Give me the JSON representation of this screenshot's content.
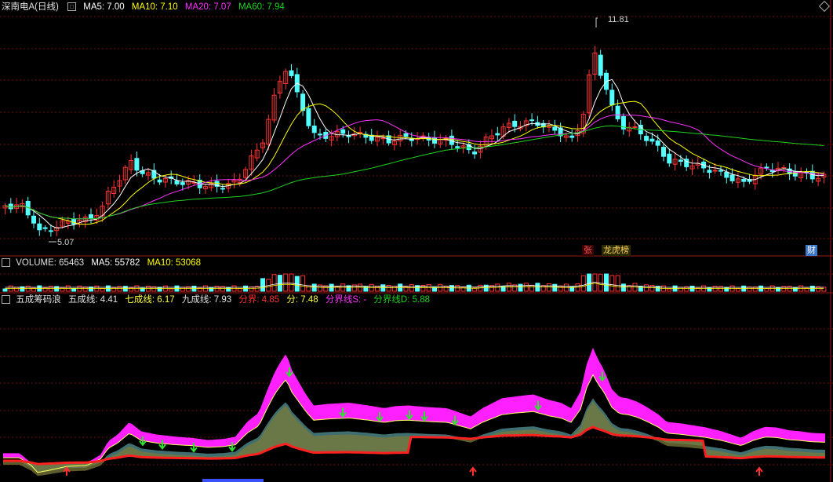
{
  "colors": {
    "up": "#ff3232",
    "down": "#54ffff",
    "ma5": "#ffffff",
    "ma10": "#ffff00",
    "ma20": "#ff32ff",
    "ma60": "#1fd321",
    "grid": "#6e1111",
    "sep": "#9b1a1a"
  },
  "main_panel": {
    "stock_name": "深南电A(日线)",
    "ma5_label": "MA5: 7.00",
    "ma10_label": "MA10: 7.10",
    "ma20_label": "MA20: 7.07",
    "ma60_label": "MA60: 7.94",
    "high_label": "11.81",
    "low_label": "5.07",
    "tags": {
      "zhang": "张",
      "longhu": "龙虎榜",
      "cai": "财"
    }
  },
  "volume_panel": {
    "volume_label": "VOLUME: 65463",
    "ma5_label": "MA5: 55782",
    "ma10_label": "MA10: 53068"
  },
  "indicator_panel": {
    "name": "五成筹码浪",
    "l50_label": "五成线: 4.41",
    "l70_label": "七成线: 6.17",
    "l90_label": "九成线: 7.93",
    "fenjie_label": "分界: 4.85",
    "fen_label": "分: 7.48",
    "fenjies_label": "分界线S: -",
    "fenjied_label": "分界线D: 5.88"
  },
  "chart_data": {
    "type": "candlestick",
    "series": [
      {
        "name": "MA5",
        "value": 7.0
      },
      {
        "name": "MA10",
        "value": 7.1
      },
      {
        "name": "MA20",
        "value": 7.07
      },
      {
        "name": "MA60",
        "value": 7.94
      }
    ],
    "annotations": {
      "max": 11.81,
      "min": 5.07
    },
    "volume": {
      "last": 65463,
      "ma5": 55782,
      "ma10": 53068
    }
  }
}
